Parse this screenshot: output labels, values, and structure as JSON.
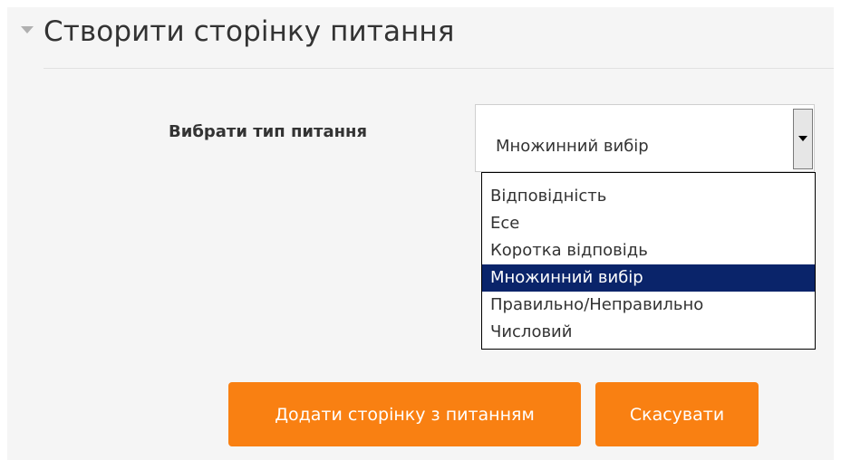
{
  "section": {
    "title": "Створити сторінку питання"
  },
  "form": {
    "question_type_label": "Вибрати тип питання",
    "question_type_value": "Множинний вибір",
    "options": [
      {
        "label": "Відповідність",
        "selected": false
      },
      {
        "label": "Есе",
        "selected": false
      },
      {
        "label": "Коротка відповідь",
        "selected": false
      },
      {
        "label": "Множинний вибір",
        "selected": true
      },
      {
        "label": "Правильно/Неправильно",
        "selected": false
      },
      {
        "label": "Числовий",
        "selected": false
      }
    ]
  },
  "buttons": {
    "add_label": "Додати сторінку з питанням",
    "cancel_label": "Скасувати"
  },
  "colors": {
    "accent": "#f98012",
    "selection": "#0a246a",
    "panel_bg": "#f5f5f5"
  }
}
